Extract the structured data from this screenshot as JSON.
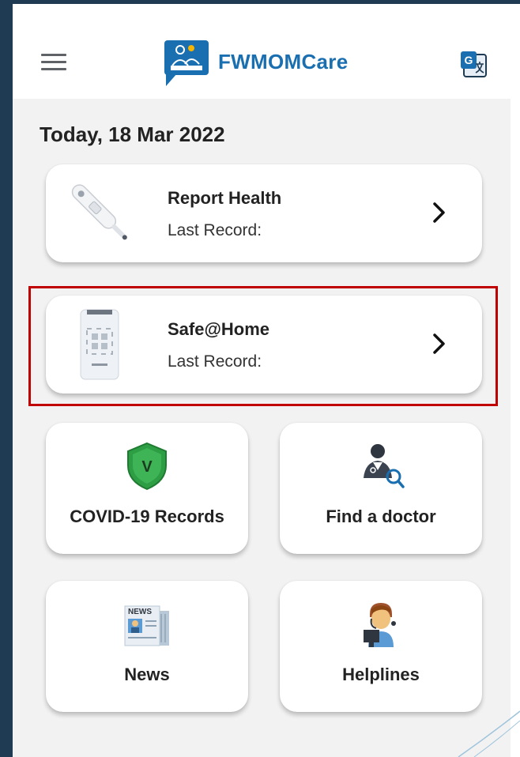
{
  "header": {
    "app_title": "FWMOMCare"
  },
  "date_label": "Today, 18 Mar 2022",
  "cards": [
    {
      "title": "Report Health",
      "subtitle": "Last Record:",
      "icon": "thermometer-icon"
    },
    {
      "title": "Safe@Home",
      "subtitle": "Last Record:",
      "icon": "device-icon"
    }
  ],
  "tiles": [
    {
      "label": "COVID-19 Records",
      "icon": "vaccine-shield-icon"
    },
    {
      "label": "Find a doctor",
      "icon": "doctor-search-icon"
    },
    {
      "label": "News",
      "icon": "newspaper-icon"
    },
    {
      "label": "Helplines",
      "icon": "helpline-agent-icon"
    }
  ],
  "colors": {
    "brand": "#1a6fb0",
    "highlight": "#c00000",
    "shield": "#2e9e44"
  }
}
